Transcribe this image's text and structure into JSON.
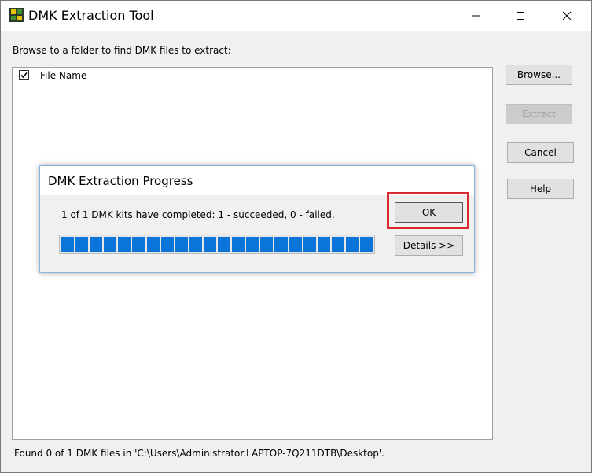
{
  "window": {
    "title": "DMK Extraction Tool",
    "icon": "dmk-app-icon"
  },
  "instructions": "Browse to a folder to find DMK files to extract:",
  "file_list": {
    "columns": [
      "File Name"
    ],
    "header_checked": true,
    "rows": []
  },
  "buttons": {
    "browse": "Browse...",
    "extract": "Extract",
    "cancel": "Cancel",
    "help": "Help"
  },
  "status_text": "Found 0 of 1 DMK files in 'C:\\Users\\Administrator.LAPTOP-7Q211DTB\\Desktop'.",
  "progress_dialog": {
    "title": "DMK Extraction Progress",
    "message": "1 of 1 DMK kits have completed: 1 - succeeded, 0 - failed.",
    "progress_fraction": 1.0,
    "ok_label": "OK",
    "details_label": "Details >>",
    "highlight_color": "#d9272e"
  },
  "colors": {
    "progress_fill": "#0a74d8"
  }
}
